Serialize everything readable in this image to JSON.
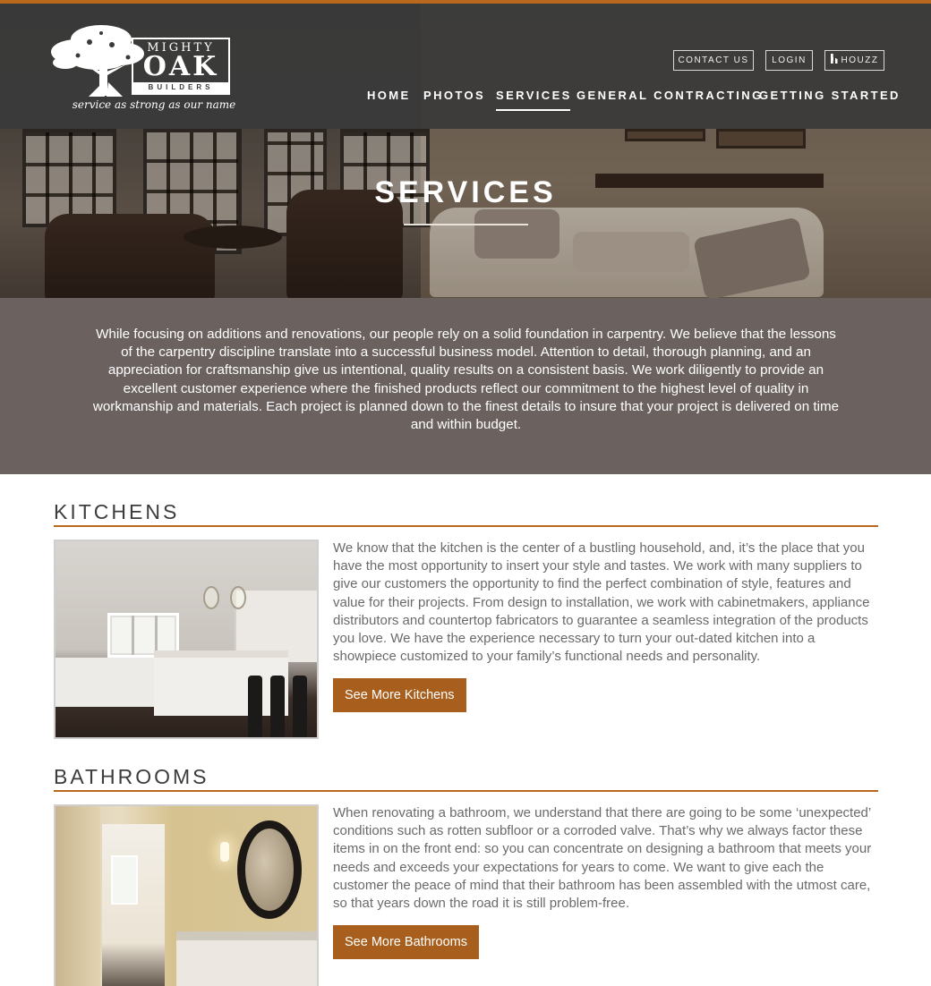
{
  "brand": {
    "line1": "MIGHTY",
    "line2": "OAK",
    "line3": "BUILDERS",
    "tagline": "service as strong as our name"
  },
  "utility_links": [
    {
      "label": "CONTACT US",
      "icon": ""
    },
    {
      "label": "LOGIN",
      "icon": ""
    },
    {
      "label": "HOUZZ",
      "icon": "houzz-icon"
    }
  ],
  "nav": [
    {
      "label": "HOME",
      "active": false
    },
    {
      "label": "PHOTOS",
      "active": false
    },
    {
      "label": "SERVICES",
      "active": true
    },
    {
      "label": "GENERAL CONTRACTING",
      "active": false
    },
    {
      "label": "GETTING STARTED",
      "active": false
    }
  ],
  "hero": {
    "title": "SERVICES"
  },
  "intro": {
    "text": "While focusing on additions and renovations, our people rely on a solid foundation in carpentry. We believe that the lessons of the carpentry discipline translate into a successful business model. Attention to detail, thorough planning, and an appreciation for craftsmanship give us intentional, quality results on a consistent basis. We work diligently to provide an excellent customer experience where the finished products reflect our commitment to the highest level of quality in workmanship and materials. Each project is planned down to the finest details to insure that your project is delivered on time and within budget."
  },
  "sections": [
    {
      "title": "KITCHENS",
      "text": "We know that the kitchen is the center of a bustling household, and, it’s the place that you have the most opportunity to insert your style and tastes. We work with many suppliers to give our customers the opportunity to find the perfect combination of style, features and value for their projects. From design to installation, we work with cabinetmakers, appliance distributors and countertop fabricators to guarantee a seamless integration of the products you love. We have the experience necessary to turn your out-dated kitchen into a showpiece customized to your family’s functional needs and personality.",
      "button": "See More Kitchens"
    },
    {
      "title": "BATHROOMS",
      "text": "When renovating a bathroom, we understand that there are going to be some ‘unexpected’ conditions such as rotten subfloor or a corroded valve. That’s why we always factor these items in on the front end: so you can concentrate on designing a bathroom that meets your needs and exceeds your expectations for years to come. We want to give each the customer the peace of mind that their bathroom has been assembled with the utmost care, so that years down the road it is still problem-free.",
      "button": "See More Bathrooms"
    }
  ],
  "colors": {
    "accent": "#b8691d",
    "button": "#a85f1d",
    "navbar": "#3a3a3a",
    "intro_band": "#6b6260"
  }
}
